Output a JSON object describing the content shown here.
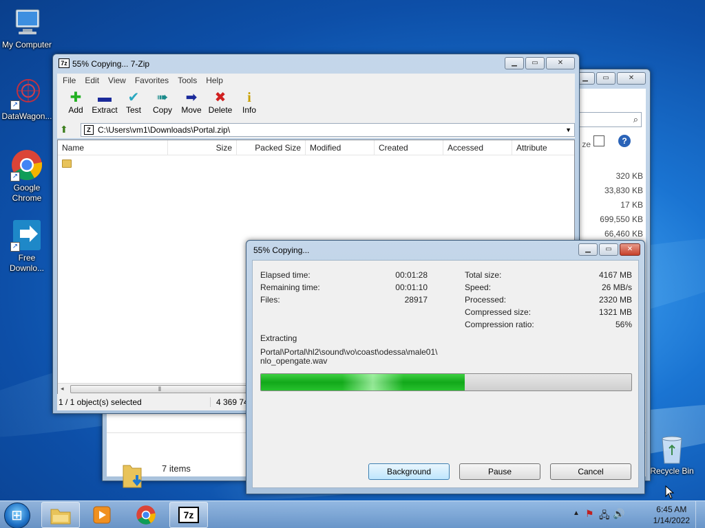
{
  "desktop": {
    "icons": [
      {
        "label": "My Computer"
      },
      {
        "label": "DataWagon..."
      },
      {
        "label": "Google Chrome"
      },
      {
        "label": "Free Downlo..."
      },
      {
        "label": "Recycle Bin"
      }
    ]
  },
  "zip_window": {
    "title": "55% Copying... 7-Zip",
    "menu": [
      "File",
      "Edit",
      "View",
      "Favorites",
      "Tools",
      "Help"
    ],
    "toolbar": [
      "Add",
      "Extract",
      "Test",
      "Copy",
      "Move",
      "Delete",
      "Info"
    ],
    "address": "C:\\Users\\vm1\\Downloads\\Portal.zip\\",
    "columns": [
      "Name",
      "Size",
      "Packed Size",
      "Modified",
      "Created",
      "Accessed",
      "Attribute"
    ],
    "status_selected": "1 / 1 object(s) selected",
    "status_size": "4 369 747"
  },
  "explorer_window": {
    "size_header": "ze",
    "sizes": [
      "320 KB",
      "33,830 KB",
      "17 KB",
      "699,550 KB",
      "66,460 KB"
    ],
    "items_count": "7 items"
  },
  "progress_dialog": {
    "title": "55% Copying...",
    "elapsed_label": "Elapsed time:",
    "elapsed_value": "00:01:28",
    "remaining_label": "Remaining time:",
    "remaining_value": "00:01:10",
    "files_label": "Files:",
    "files_value": "28917",
    "total_label": "Total size:",
    "total_value": "4167 MB",
    "speed_label": "Speed:",
    "speed_value": "26 MB/s",
    "processed_label": "Processed:",
    "processed_value": "2320 MB",
    "compressed_label": "Compressed size:",
    "compressed_value": "1321 MB",
    "ratio_label": "Compression ratio:",
    "ratio_value": "56%",
    "operation": "Extracting",
    "path_line1": "Portal\\Portal\\hl2\\sound\\vo\\coast\\odessa\\male01\\",
    "path_line2": "nlo_opengate.wav",
    "progress_fraction": 0.55,
    "background_label": "Background",
    "pause_label": "Pause",
    "cancel_label": "Cancel"
  },
  "taskbar": {
    "time": "6:45 AM",
    "date": "1/14/2022"
  }
}
